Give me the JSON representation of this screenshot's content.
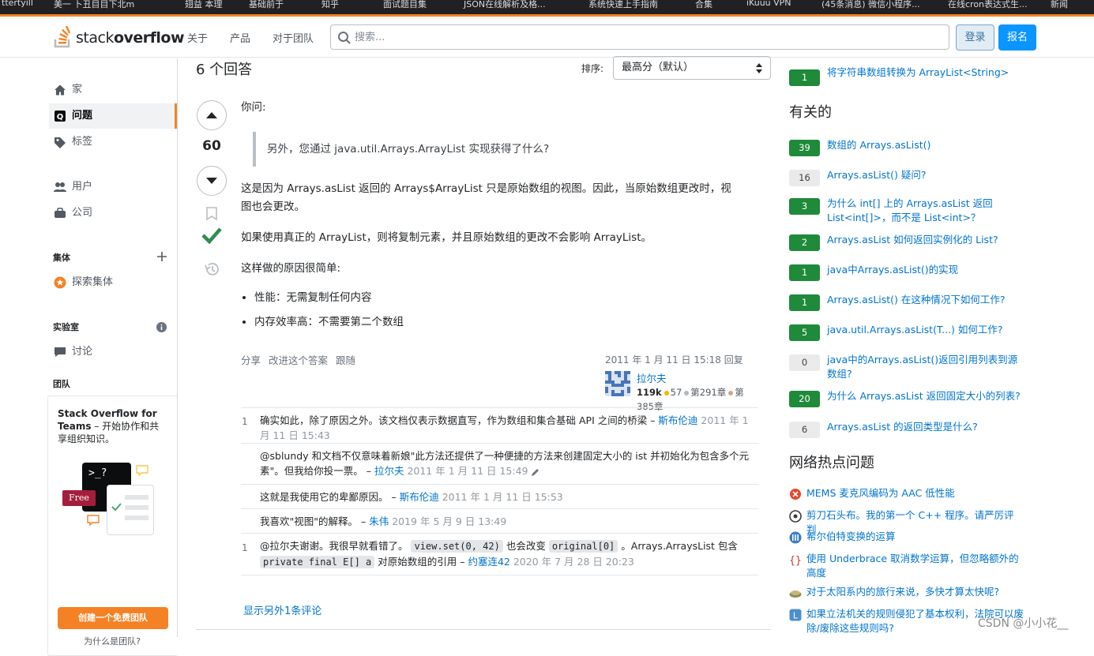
{
  "browser": {
    "bookmarks": [
      "ttertyill",
      "美一 卜丑目目下北m",
      "翅益 本理",
      "基础前于",
      "知乎",
      "面试题目集",
      "JSON在线解析及格...",
      "系统快速上手指南",
      "合集",
      "iKuuu VPN",
      "(45条消息) 微信小程序...",
      "在线cron表达式生...",
      "新闻"
    ]
  },
  "header": {
    "logo_text_light": "stack",
    "logo_text_bold": "overflow",
    "nav": [
      "关于",
      "产品",
      "对于团队"
    ],
    "search_placeholder": "搜索...",
    "login": "登录",
    "signup": "报名"
  },
  "leftnav": {
    "home": "家",
    "questions": "问题",
    "tags": "标签",
    "users": "用户",
    "companies": "公司",
    "collectives_head": "集体",
    "explore_collectives": "探索集体",
    "labs_head": "实验室",
    "discussions": "讨论",
    "teams_head": "团队",
    "teams_title_bold": "Stack Overflow for Teams",
    "teams_title_rest": " – 开始协作和共享组织知识。",
    "free_badge": "Free",
    "teams_prompt": ">_?",
    "teams_button": "创建一个免费团队",
    "teams_why": "为什么是团队?"
  },
  "answers": {
    "count_label": "6 个回答",
    "sort_label": "排序:",
    "sort_value": "最高分（默认）"
  },
  "answer": {
    "votes": "60",
    "intro": "你问:",
    "quote": "另外，您通过 java.util.Arrays.ArrayList 实现获得了什么?",
    "para1_line1": "这是因为 Arrays.asList 返回的 Arrays$ArrayList 只是原始数组的视图。因此，当原始数组更改时，视",
    "para1_line2": "图也会更改。",
    "para2": "如果使用真正的 ArrayList，则将复制元素，并且原始数组的更改不会影响 ArrayList。",
    "para3": "这样做的原因很简单:",
    "bullets": [
      "性能：无需复制任何内容",
      "内存效率高：不需要第二个数组"
    ],
    "actions": [
      "分享",
      "改进这个答案",
      "跟随"
    ],
    "answered": "2011 年 1 月 11 日 15:18 回复",
    "user_name": "拉尔夫",
    "user_rep": "119k",
    "gold": "57",
    "silver": "第291章",
    "bronze_line1": "第",
    "bronze_line2": "385章"
  },
  "comments": [
    {
      "score": "1",
      "text": "确实如此，除了原因之外。该文档仅表示数据直写，作为数组和集合基础 API 之间的桥梁 – ",
      "author": "斯布伦迪",
      "date": "2011 年 1 月 11 日 15:43"
    },
    {
      "score": "",
      "text": "@sblundy 和文档不仅意味着新娘\"此方法还提供了一种便捷的方法来创建固定大小的 ist 并初始化为包含多个元素\"。但我给你投一票。 – ",
      "author": "拉尔夫",
      "date": "2011 年 1 月 11 日 15:49"
    },
    {
      "score": "",
      "text": "这就是我使用它的卑鄙原因。 – ",
      "author": "斯布伦迪",
      "date": "2011 年 1 月 11 日 15:53"
    },
    {
      "score": "",
      "text": "我喜欢\"视图\"的解释。 – ",
      "author": "朱伟",
      "date": "2019 年 5 月 9 日 13:49"
    },
    {
      "score": "1",
      "text_a": "@拉尔夫谢谢。我很早就看错了。 ",
      "code_a": "view.set(0, 42)",
      "text_b": " 也会改变 ",
      "code_b": "original[0]",
      "text_c": " 。Arrays.ArraysList 包含 ",
      "code_c": "private final E[] a",
      "text_d": " 对原始数组的引用 – ",
      "author": "约塞连42",
      "date": "2020 年 7 月 28 日 20:23"
    }
  ],
  "show_more": "显示另外1条评论",
  "right": {
    "linked_top": {
      "count": "1",
      "title": "将字符串数组转换为 ArrayList<String>"
    },
    "related_head": "有关的",
    "related": [
      {
        "count": "39",
        "answered": true,
        "title": "数组的 Arrays.asList()"
      },
      {
        "count": "16",
        "answered": false,
        "title": "Arrays.asList() 疑问?"
      },
      {
        "count": "3",
        "answered": true,
        "title": "为什么 int[] 上的 Arrays.asList 返回 List<int[]>，而不是 List<int>？"
      },
      {
        "count": "2",
        "answered": true,
        "title": "Arrays.asList 如何返回实例化的 List?"
      },
      {
        "count": "1",
        "answered": true,
        "title": "java中Arrays.asList()的实现"
      },
      {
        "count": "1",
        "answered": true,
        "title": "Arrays.asList() 在这种情况下如何工作?"
      },
      {
        "count": "5",
        "answered": true,
        "title": "java.util.Arrays.asList(T...) 如何工作?"
      },
      {
        "count": "0",
        "answered": false,
        "title": "java中的Arrays.asList()返回引用列表到源数组?"
      },
      {
        "count": "20",
        "answered": true,
        "title": "为什么 Arrays.asList 返回固定大小的列表?"
      },
      {
        "count": "6",
        "answered": false,
        "title": "Arrays.asList 的返回类型是什么?"
      }
    ],
    "hot_head": "网络热点问题",
    "hot": [
      {
        "icon": "electronics-icon",
        "color": "#e34a2f",
        "title": "MEMS 麦克风编码为 AAC 低性能"
      },
      {
        "icon": "codegolf-icon",
        "color": "#3b3b3b",
        "title": "剪刀石头布。我的第一个 C++ 程序。请严厉评判"
      },
      {
        "icon": "dsp-icon",
        "color": "#3a7ec2",
        "title": "希尔伯特变换的运算"
      },
      {
        "icon": "tex-icon",
        "color": "#c53a2a",
        "title": "使用 Underbrace 取消数学运算，但忽略额外的高度"
      },
      {
        "icon": "worldbuilding-icon",
        "color": "#8a8f5a",
        "title": "对于太阳系内的旅行来说，多快才算太快呢?"
      },
      {
        "icon": "law-icon",
        "color": "#4c8fd0",
        "title": "如果立法机关的规则侵犯了基本权利，法院可以废除/废除这些规则吗?"
      }
    ]
  },
  "watermark": "CSDN @小小花__"
}
